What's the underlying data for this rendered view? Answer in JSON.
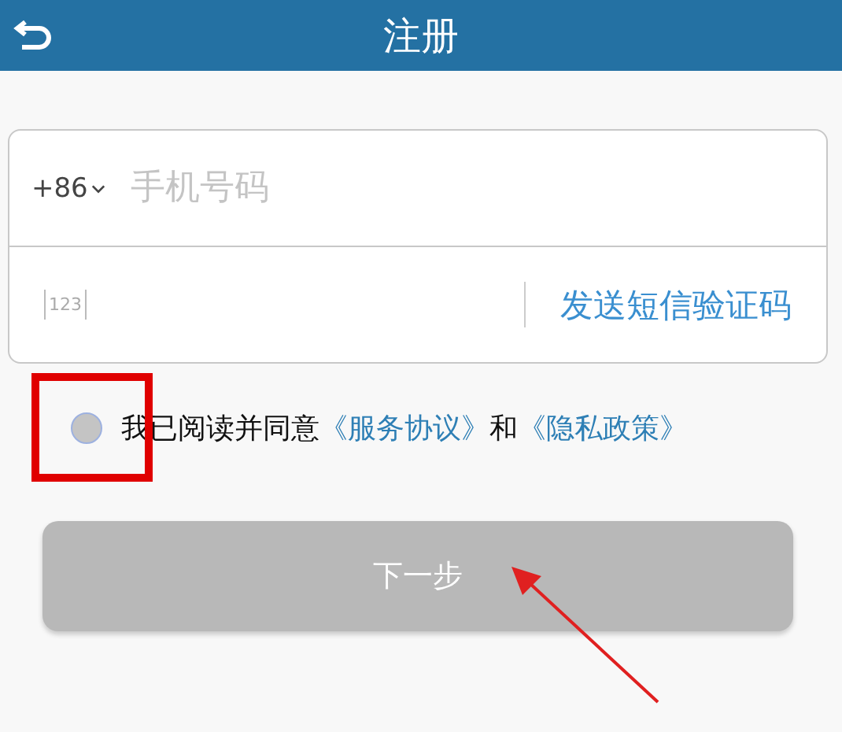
{
  "header": {
    "title": "注册"
  },
  "phone": {
    "country_code": "+86",
    "placeholder": "手机号码"
  },
  "code": {
    "icon_text": "123",
    "send_button": "发送短信验证码"
  },
  "agreement": {
    "checked": false,
    "prefix": "我已阅读并同意",
    "terms_link": "《服务协议》",
    "joiner": "和",
    "privacy_link": "《隐私政策》"
  },
  "next_button": {
    "label": "下一步",
    "disabled": true
  },
  "annotations": [
    {
      "kind": "box",
      "color": "#e00000"
    },
    {
      "kind": "arrow",
      "color": "#e02020"
    }
  ]
}
